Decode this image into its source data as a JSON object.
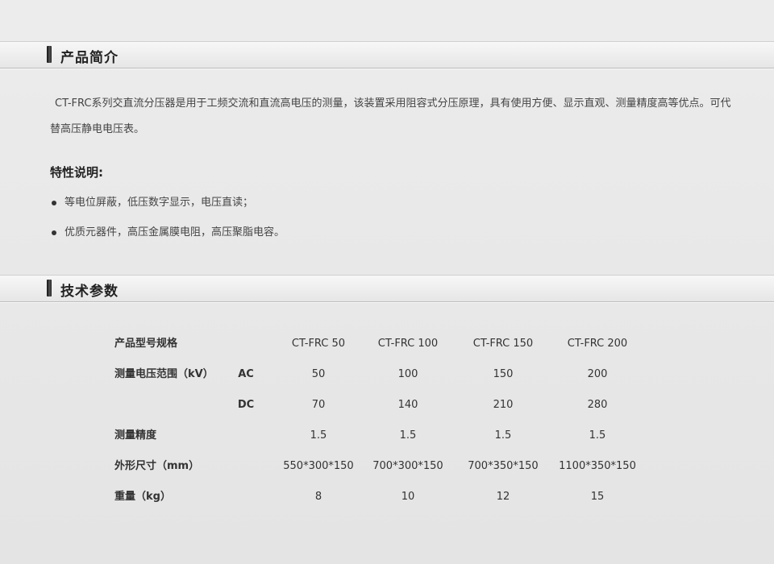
{
  "sections": {
    "intro_title": "产品简介",
    "spec_title": "技术参数"
  },
  "intro": {
    "text": "CT-FRC系列交直流分压器是用于工频交流和直流高电压的测量，该装置采用阻容式分压原理，具有使用方便、显示直观、测量精度高等优点。可代替高压静电电压表。",
    "features_title": "特性说明:",
    "features": [
      "等电位屏蔽，低压数字显示，电压直读；",
      "优质元器件，高压金属膜电阻，高压聚脂电容。"
    ]
  },
  "spec": {
    "rows": [
      {
        "label": "产品型号规格",
        "sub": "",
        "values": [
          "CT-FRC 50",
          "CT-FRC 100",
          "CT-FRC 150",
          "CT-FRC 200"
        ]
      },
      {
        "label": "测量电压范围（kV）",
        "sub": "AC",
        "values": [
          "50",
          "100",
          "150",
          "200"
        ]
      },
      {
        "label": "",
        "sub": "DC",
        "values": [
          "70",
          "140",
          "210",
          "280"
        ]
      },
      {
        "label": "测量精度",
        "sub": "",
        "values": [
          "1.5",
          "1.5",
          "1.5",
          "1.5"
        ]
      },
      {
        "label": "外形尺寸（mm）",
        "sub": "",
        "values": [
          "550*300*150",
          "700*300*150",
          "700*350*150",
          "1100*350*150"
        ]
      },
      {
        "label": "重量（kg）",
        "sub": "",
        "values": [
          "8",
          "10",
          "12",
          "15"
        ]
      }
    ]
  }
}
